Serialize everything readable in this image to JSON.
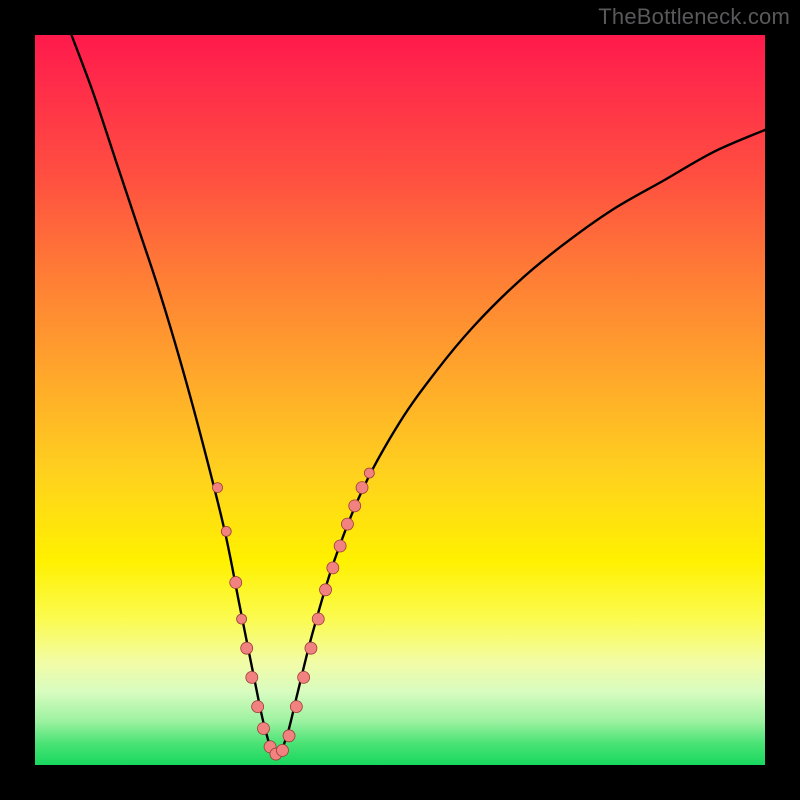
{
  "watermark": "TheBottleneck.com",
  "colors": {
    "curve": "#000000",
    "dot_fill": "#f1827f",
    "dot_stroke": "#9a3c3a"
  },
  "chart_data": {
    "type": "line",
    "title": "",
    "xlabel": "",
    "ylabel": "",
    "xlim": [
      0,
      100
    ],
    "ylim": [
      0,
      100
    ],
    "notch_x": 33,
    "series": [
      {
        "name": "bottleneck-curve",
        "x": [
          5,
          8,
          11,
          14,
          17,
          20,
          23,
          26,
          28,
          30,
          31.5,
          33,
          34.5,
          36,
          38,
          41,
          45,
          50,
          55,
          60,
          66,
          72,
          79,
          86,
          93,
          100
        ],
        "y": [
          100,
          92,
          83,
          74,
          65,
          55,
          44,
          32,
          22,
          12,
          5,
          1,
          4,
          10,
          18,
          28,
          38,
          47,
          54,
          60,
          66,
          71,
          76,
          80,
          84,
          87
        ]
      }
    ],
    "dots": [
      {
        "x": 25.0,
        "y": 38,
        "r": 5
      },
      {
        "x": 26.2,
        "y": 32,
        "r": 5
      },
      {
        "x": 27.5,
        "y": 25,
        "r": 6
      },
      {
        "x": 28.3,
        "y": 20,
        "r": 5
      },
      {
        "x": 29.0,
        "y": 16,
        "r": 6
      },
      {
        "x": 29.7,
        "y": 12,
        "r": 6
      },
      {
        "x": 30.5,
        "y": 8,
        "r": 6
      },
      {
        "x": 31.3,
        "y": 5,
        "r": 6
      },
      {
        "x": 32.2,
        "y": 2.5,
        "r": 6
      },
      {
        "x": 33.0,
        "y": 1.5,
        "r": 6
      },
      {
        "x": 33.9,
        "y": 2,
        "r": 6
      },
      {
        "x": 34.8,
        "y": 4,
        "r": 6
      },
      {
        "x": 35.8,
        "y": 8,
        "r": 6
      },
      {
        "x": 36.8,
        "y": 12,
        "r": 6
      },
      {
        "x": 37.8,
        "y": 16,
        "r": 6
      },
      {
        "x": 38.8,
        "y": 20,
        "r": 6
      },
      {
        "x": 39.8,
        "y": 24,
        "r": 6
      },
      {
        "x": 40.8,
        "y": 27,
        "r": 6
      },
      {
        "x": 41.8,
        "y": 30,
        "r": 6
      },
      {
        "x": 42.8,
        "y": 33,
        "r": 6
      },
      {
        "x": 43.8,
        "y": 35.5,
        "r": 6
      },
      {
        "x": 44.8,
        "y": 38,
        "r": 6
      },
      {
        "x": 45.8,
        "y": 40,
        "r": 5
      }
    ]
  }
}
